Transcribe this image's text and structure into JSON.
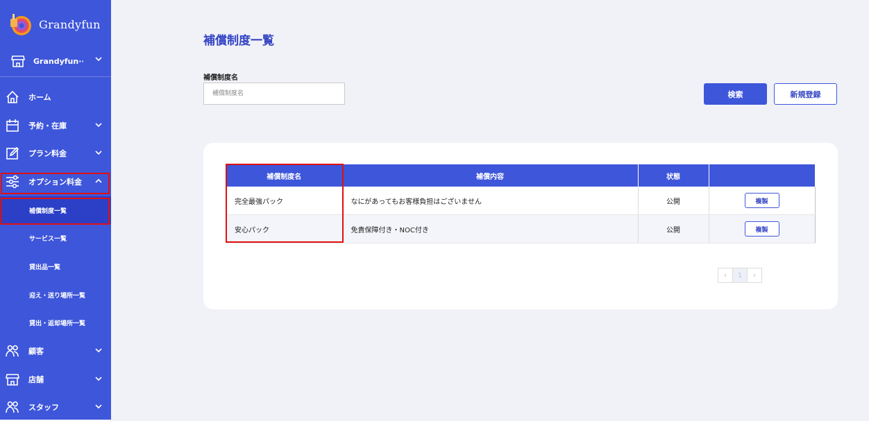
{
  "brand": {
    "name": "Grandyfun"
  },
  "sidebar": {
    "store_name": "Grandyfun···",
    "items": [
      {
        "label": "ホーム"
      },
      {
        "label": "予約・在庫"
      },
      {
        "label": "プラン料金"
      },
      {
        "label": "オプション料金"
      },
      {
        "label": "顧客"
      },
      {
        "label": "店舗"
      },
      {
        "label": "スタッフ"
      }
    ],
    "subitems": [
      {
        "label": "補償制度一覧"
      },
      {
        "label": "サービス一覧"
      },
      {
        "label": "貸出品一覧"
      },
      {
        "label": "迎え・送り場所一覧"
      },
      {
        "label": "貸出・返却場所一覧"
      }
    ]
  },
  "main": {
    "title": "補償制度一覧",
    "search": {
      "label": "補償制度名",
      "placeholder": "補償制度名",
      "value": ""
    },
    "search_button": "検索",
    "new_button": "新規登録"
  },
  "table": {
    "headers": [
      "補償制度名",
      "補償内容",
      "状態",
      ""
    ],
    "rows": [
      {
        "name": "完全最強パック",
        "content": "なにがあってもお客様負担はございません",
        "status": "公開",
        "action": "複製"
      },
      {
        "name": "安心パック",
        "content": "免責保障付き・NOC付き",
        "status": "公開",
        "action": "複製"
      }
    ]
  },
  "pagination": {
    "prev": "‹",
    "page": "1",
    "next": "›"
  },
  "colors": {
    "primary": "#3e56da",
    "active": "#2b3fc7",
    "highlight": "#e01010",
    "background": "#f1f2f8"
  }
}
